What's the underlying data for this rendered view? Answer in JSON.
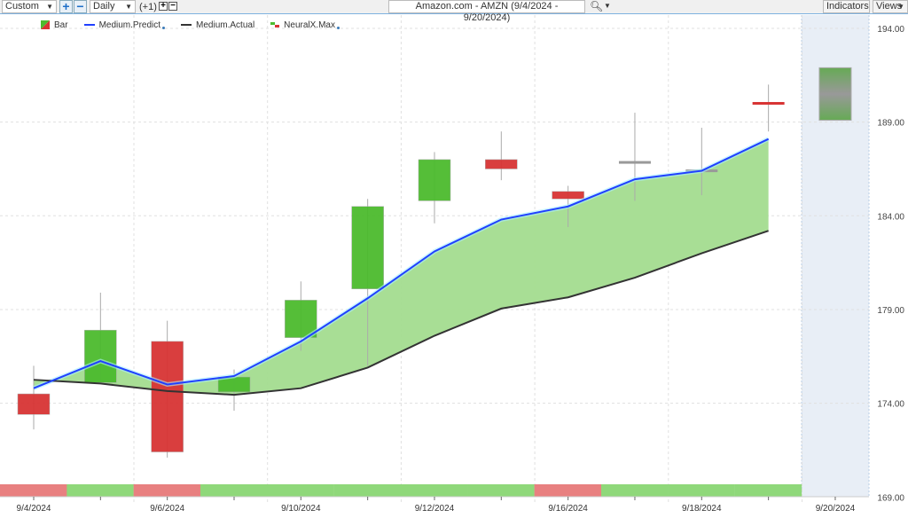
{
  "toolbar": {
    "range_select": "Custom",
    "interval_select": "Daily",
    "offset": "(+1)",
    "title": "Amazon.com - AMZN (9/4/2024 - 9/20/2024)",
    "indicators": "Indicators",
    "views": "Views"
  },
  "legend": [
    {
      "label": "Bar"
    },
    {
      "label": "Medium.Predict"
    },
    {
      "label": "Medium.Actual"
    },
    {
      "label": "NeuralX.Max"
    }
  ],
  "colors": {
    "up": "#4cbb2e",
    "down": "#d83434",
    "predict": "#2040ff",
    "actual": "#333333",
    "fill": "#a3dc8f"
  },
  "chart_data": {
    "type": "candlestick",
    "title": "Amazon.com - AMZN (9/4/2024 - 9/20/2024)",
    "x": [
      "9/4/2024",
      "9/5/2024",
      "9/6/2024",
      "9/9/2024",
      "9/10/2024",
      "9/11/2024",
      "9/12/2024",
      "9/13/2024",
      "9/16/2024",
      "9/17/2024",
      "9/18/2024",
      "9/19/2024",
      "9/20/2024"
    ],
    "x_tick_labels": [
      "9/4/2024",
      "9/6/2024",
      "9/10/2024",
      "9/12/2024",
      "9/16/2024",
      "9/18/2024",
      "9/20/2024"
    ],
    "y_tick_labels": [
      "194.00",
      "189.00",
      "184.00",
      "179.00",
      "174.00",
      "169.00"
    ],
    "ylim": [
      169,
      194.8
    ],
    "ohlc": [
      [
        174.5,
        176.0,
        172.6,
        173.4
      ],
      [
        175.1,
        179.9,
        175.1,
        177.9
      ],
      [
        177.3,
        178.4,
        171.1,
        171.4
      ],
      [
        174.6,
        175.8,
        173.6,
        175.4
      ],
      [
        177.5,
        180.5,
        176.8,
        179.5
      ],
      [
        180.1,
        184.9,
        176.0,
        184.5
      ],
      [
        184.8,
        187.4,
        183.6,
        187.0
      ],
      [
        187.0,
        188.5,
        185.9,
        186.5
      ],
      [
        185.3,
        185.6,
        183.4,
        184.9
      ],
      [
        186.85,
        189.5,
        184.8,
        186.85
      ],
      [
        186.4,
        188.7,
        185.1,
        186.4
      ],
      [
        190.0,
        191.0,
        188.5,
        189.9
      ]
    ],
    "forecast": {
      "date": "9/20/2024",
      "high": 191.9,
      "low": 189.1
    },
    "series": [
      {
        "name": "Medium.Predict",
        "values": [
          174.8,
          176.25,
          175.0,
          175.45,
          177.3,
          179.6,
          182.1,
          183.8,
          184.5,
          185.95,
          186.4,
          188.1
        ]
      },
      {
        "name": "Medium.Actual",
        "values": [
          175.25,
          175.05,
          174.65,
          174.45,
          174.8,
          175.9,
          177.6,
          179.05,
          179.65,
          180.7,
          182.0,
          183.2
        ]
      }
    ],
    "neuralx_strip": [
      "down",
      "up",
      "down",
      "up",
      "up",
      "up",
      "up",
      "up",
      "down",
      "up",
      "up",
      "up"
    ],
    "grid": true
  }
}
